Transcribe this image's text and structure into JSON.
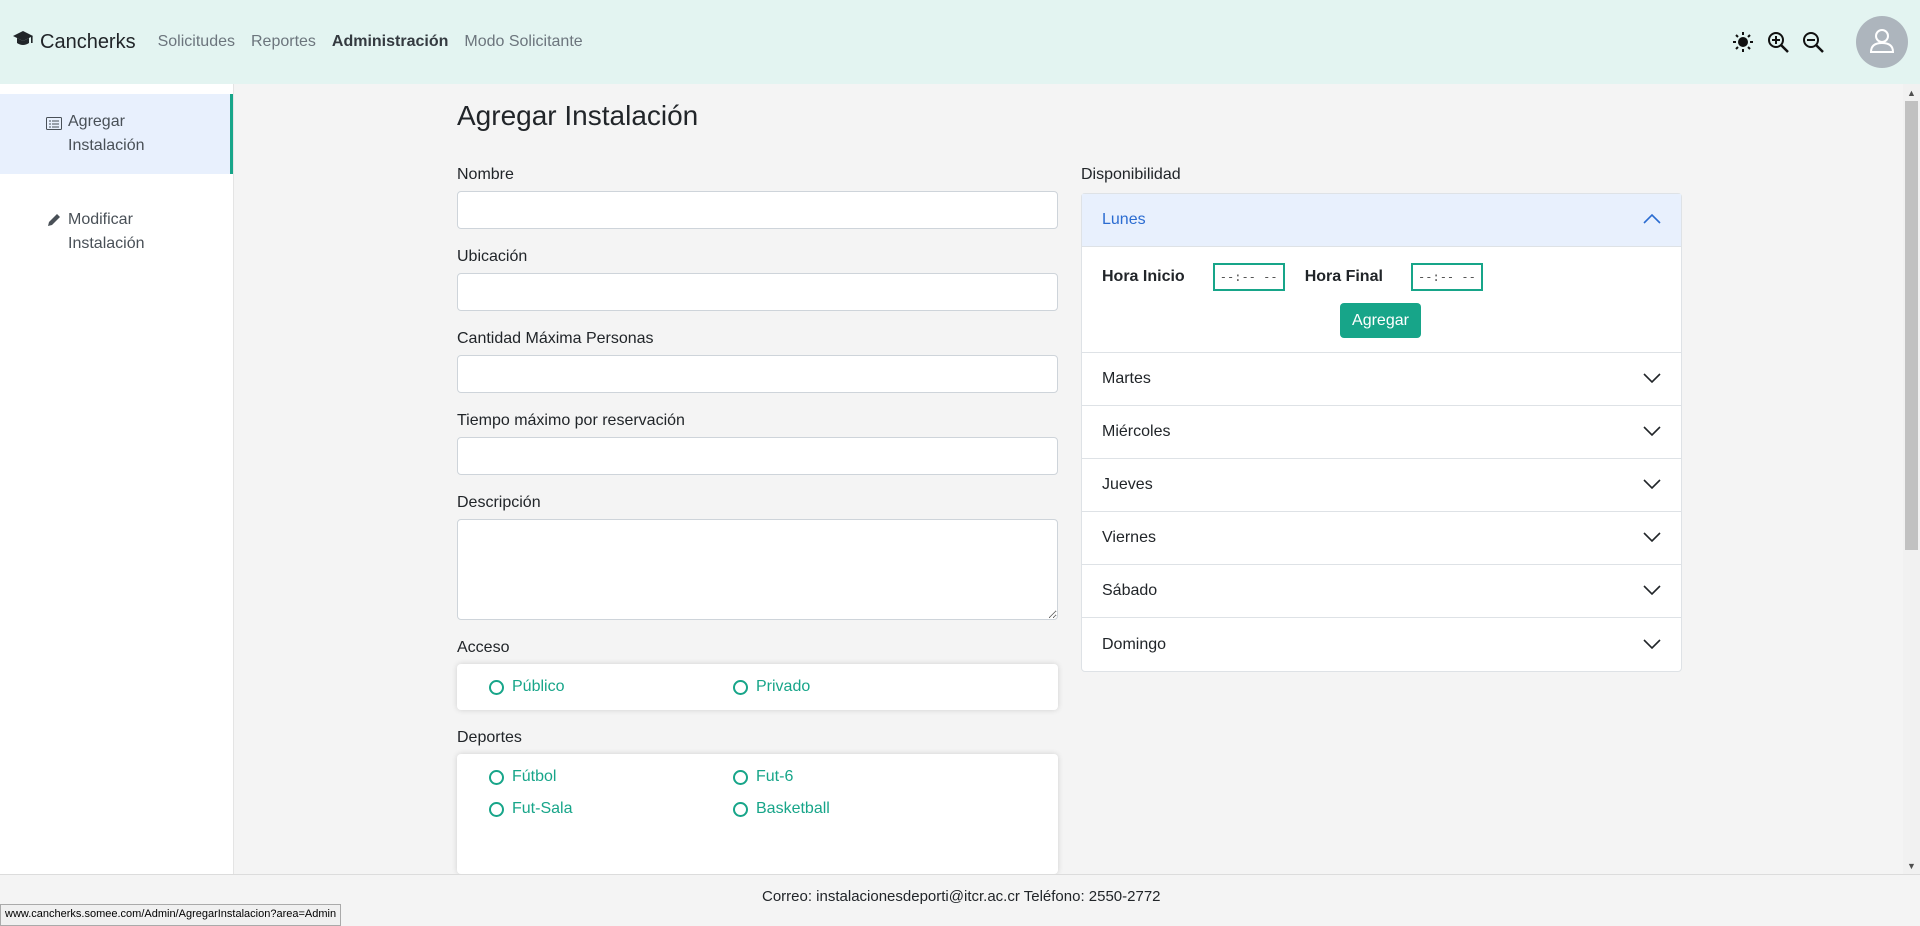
{
  "navbar": {
    "brand": "Cancherks",
    "links": [
      "Solicitudes",
      "Reportes",
      "Administración",
      "Modo Solicitante"
    ],
    "active_link": "Administración",
    "icons": [
      "sun-icon",
      "zoom-in-icon",
      "zoom-out-icon",
      "user-icon"
    ]
  },
  "sidebar": {
    "items": [
      {
        "label": "Agregar Instalación",
        "icon": "form-icon",
        "active": true
      },
      {
        "label": "Modificar Instalación",
        "icon": "pencil-icon",
        "active": false
      }
    ]
  },
  "page_title": "Agregar Instalación",
  "form": {
    "nombre_label": "Nombre",
    "nombre_value": "",
    "ubicacion_label": "Ubicación",
    "ubicacion_value": "",
    "cantidad_label": "Cantidad Máxima Personas",
    "cantidad_value": "",
    "tiempo_label": "Tiempo máximo por reservación",
    "tiempo_value": "",
    "descripcion_label": "Descripción",
    "descripcion_value": "",
    "acceso_label": "Acceso",
    "acceso_options": [
      "Público",
      "Privado"
    ],
    "deportes_label": "Deportes",
    "deportes_options": [
      "Fútbol",
      "Fut-6",
      "Fut-Sala",
      "Basketball"
    ]
  },
  "availability": {
    "label": "Disponibilidad",
    "days": [
      "Lunes",
      "Martes",
      "Miércoles",
      "Jueves",
      "Viernes",
      "Sábado",
      "Domingo"
    ],
    "open_day": "Lunes",
    "hora_inicio_label": "Hora Inicio",
    "hora_inicio_value": "--:-- --",
    "hora_final_label": "Hora Final",
    "hora_final_value": "--:-- --",
    "agregar_label": "Agregar"
  },
  "footer": {
    "text": "Correo: instalacionesdeporti@itcr.ac.cr Teléfono: 2550-2772"
  },
  "status_url": "www.cancherks.somee.com/Admin/AgregarInstalacion?area=Admin",
  "colors": {
    "navbar_bg": "#e3f4f1",
    "accent": "#17a589",
    "accordion_open_bg": "#e8f0fd",
    "accordion_open_text": "#2b6cd1"
  }
}
